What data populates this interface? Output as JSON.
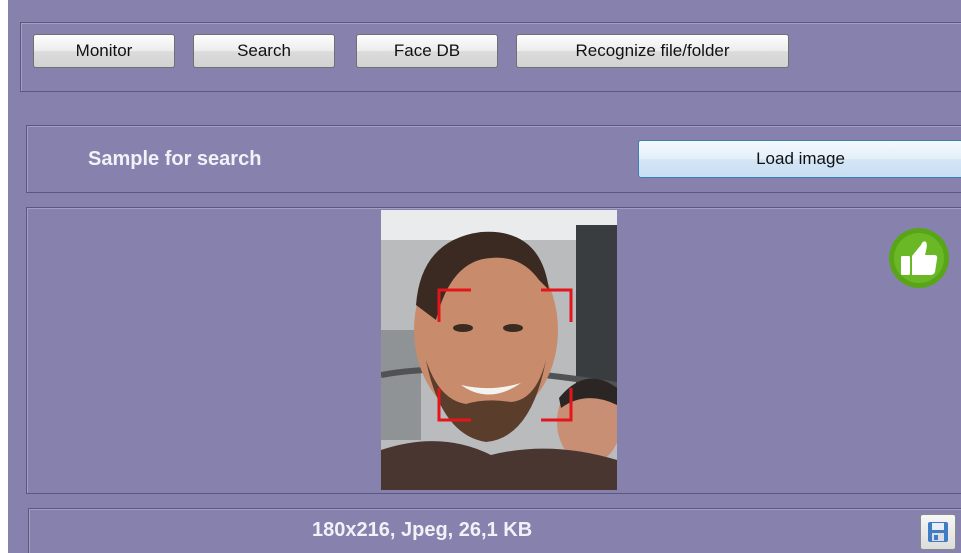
{
  "toolbar": {
    "buttons": [
      "Monitor",
      "Search",
      "Face DB",
      "Recognize file/folder"
    ]
  },
  "sample": {
    "label": "Sample for search",
    "load_button": "Load image"
  },
  "image": {
    "status_icon": "thumbs-up-icon",
    "face_marker_color": "#e4161b",
    "info": "180x216, Jpeg, 26,1 KB",
    "save_icon": "save-icon"
  },
  "colors": {
    "panel_bg": "#8781ad",
    "ok_green": "#58a617"
  }
}
